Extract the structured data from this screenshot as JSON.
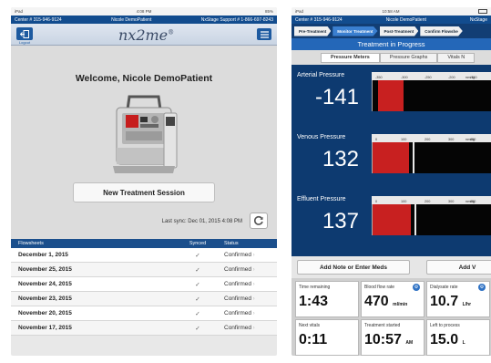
{
  "left": {
    "status": {
      "device": "iPad",
      "time": "4:08 PM",
      "battery": "85%"
    },
    "info": {
      "center": "Center # 315-946-9124",
      "patient": "Nicole DemoPatient",
      "support": "NxStage Support # 1-866-697-8243"
    },
    "nav": {
      "logout_label": "Logout",
      "logo": "nx2me",
      "logo_sup": "®"
    },
    "welcome": "Welcome, Nicole DemoPatient",
    "new_session_label": "New Treatment Session",
    "last_sync": "Last sync: Dec 01, 2015 4:08 PM",
    "table": {
      "headers": {
        "flowsheets": "Flowsheets",
        "synced": "Synced",
        "status": "Status"
      },
      "rows": [
        {
          "date": "December 1, 2015",
          "synced": "✓",
          "status": "Confirmed"
        },
        {
          "date": "November 25, 2015",
          "synced": "✓",
          "status": "Confirmed"
        },
        {
          "date": "November 24, 2015",
          "synced": "✓",
          "status": "Confirmed"
        },
        {
          "date": "November 23, 2015",
          "synced": "✓",
          "status": "Confirmed"
        },
        {
          "date": "November 20, 2015",
          "synced": "✓",
          "status": "Confirmed"
        },
        {
          "date": "November 17, 2015",
          "synced": "✓",
          "status": "Confirmed"
        }
      ]
    }
  },
  "right": {
    "status": {
      "device": "iPad",
      "time": "10:58 AM"
    },
    "info": {
      "center": "Center # 315-946-9124",
      "patient": "Nicole DemoPatient",
      "support": "NxStage"
    },
    "steps": [
      {
        "label": "Pre-Treatment",
        "active": false
      },
      {
        "label": "Monitor Treatment",
        "active": true
      },
      {
        "label": "Post-Treatment",
        "active": false
      },
      {
        "label": "Confirm Flowshe",
        "active": false
      }
    ],
    "progress_title": "Treatment in Progress",
    "tabs": [
      {
        "label": "Pressure Meters",
        "active": true
      },
      {
        "label": "Pressure Graphs",
        "active": false
      },
      {
        "label": "Vitals N",
        "active": false
      }
    ],
    "meters": [
      {
        "label": "Arterial Pressure",
        "value": "-141",
        "unit": "mmHg",
        "ticks": [
          "-350",
          "-300",
          "-250",
          "-200",
          "-150"
        ]
      },
      {
        "label": "Venous Pressure",
        "value": "132",
        "unit": "mmHg",
        "ticks": [
          "0",
          "100",
          "200",
          "300",
          "400"
        ]
      },
      {
        "label": "Effluent Pressure",
        "value": "137",
        "unit": "mmHg",
        "ticks": [
          "0",
          "100",
          "200",
          "300",
          "400"
        ]
      }
    ],
    "buttons": {
      "note_label": "Add Note or Enter Meds",
      "add_label": "Add V"
    },
    "stats": [
      {
        "label": "Time remaining",
        "value": "1:43",
        "unit": "",
        "info": false
      },
      {
        "label": "Blood flow rate",
        "value": "470",
        "unit": "ml/min",
        "info": true
      },
      {
        "label": "Dialysate rate",
        "value": "10.7",
        "unit": "L/hr",
        "info": true
      },
      {
        "label": "Next vitals",
        "value": "0:11",
        "unit": "",
        "info": false
      },
      {
        "label": "Treatment started",
        "value": "10:57",
        "unit": "AM",
        "info": false
      },
      {
        "label": "Left to process",
        "value": "15.0",
        "unit": "L",
        "info": false
      }
    ]
  },
  "colors": {
    "header_blue": "#124c8e",
    "accent_blue": "#2467b8",
    "meter_red": "#c82020"
  }
}
